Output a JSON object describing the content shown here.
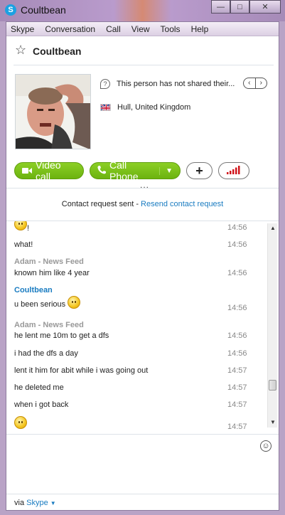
{
  "window": {
    "title": "Coultbean",
    "app_icon": "skype-icon",
    "min_glyph": "—",
    "max_glyph": "□",
    "close_glyph": "✕"
  },
  "menu": [
    "Skype",
    "Conversation",
    "Call",
    "View",
    "Tools",
    "Help"
  ],
  "header": {
    "contact_name": "Coultbean",
    "favorite_icon": "star-icon"
  },
  "profile": {
    "mood_text": "This person has not shared their...",
    "location": "Hull, United Kingdom",
    "pager_prev": "‹",
    "pager_next": "›"
  },
  "actions": {
    "video_call": "Video call",
    "call_phone": "Call Phone",
    "add_icon": "+",
    "more_dots": "..."
  },
  "request": {
    "text": "Contact request sent - ",
    "link": "Resend contact request"
  },
  "chat": {
    "messages": [
      {
        "text": "!",
        "time": "14:56",
        "has_emoji": true
      },
      {
        "text": "what!",
        "time": "14:56"
      },
      {
        "sender": "Adam - News Feed",
        "text": "known him like 4 year",
        "time": "14:56"
      },
      {
        "sender": "Coultbean",
        "text": "u been serious",
        "time": "14:56",
        "has_emoji": true
      },
      {
        "sender": "Adam - News Feed",
        "text": "he lent me 10m to get a dfs",
        "time": "14:56"
      },
      {
        "text": "i had the dfs a day",
        "time": "14:56"
      },
      {
        "text": "lent it him for abit while i was going out",
        "time": "14:57"
      },
      {
        "text": "he deleted me",
        "time": "14:57"
      },
      {
        "text": "when i got back",
        "time": "14:57"
      },
      {
        "text": "",
        "time": "14:57",
        "has_emoji": true
      }
    ]
  },
  "footer": {
    "via_text": "via ",
    "via_link": "Skype"
  },
  "colors": {
    "accent_green": "#6cb30f",
    "link_blue": "#1a7cc1",
    "sender_other": "#999999",
    "sender_self": "#1a7cc1"
  }
}
